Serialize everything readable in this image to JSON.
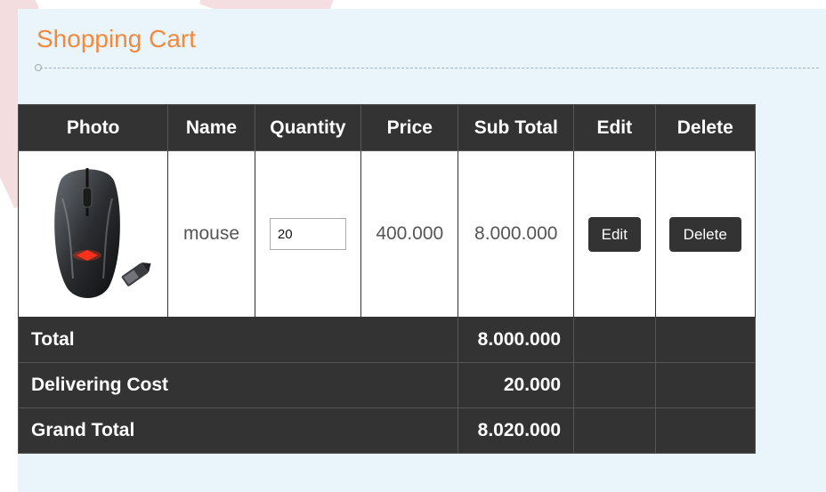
{
  "page": {
    "title": "Shopping Cart"
  },
  "cart": {
    "headers": {
      "photo": "Photo",
      "name": "Name",
      "quantity": "Quantity",
      "price": "Price",
      "subtotal": "Sub Total",
      "edit": "Edit",
      "delete": "Delete"
    },
    "items": [
      {
        "photo_icon": "computer-mouse-image",
        "name": "mouse",
        "quantity": "20",
        "price": "400.000",
        "subtotal": "8.000.000",
        "edit_label": "Edit",
        "delete_label": "Delete"
      }
    ],
    "summary": {
      "total_label": "Total",
      "total_value": "8.000.000",
      "delivery_label": "Delivering Cost",
      "delivery_value": "20.000",
      "grand_label": "Grand Total",
      "grand_value": "8.020.000"
    }
  },
  "colors": {
    "title": "#f28a3d",
    "header_bg": "#333333",
    "panel_bg": "#eaf4fb"
  }
}
